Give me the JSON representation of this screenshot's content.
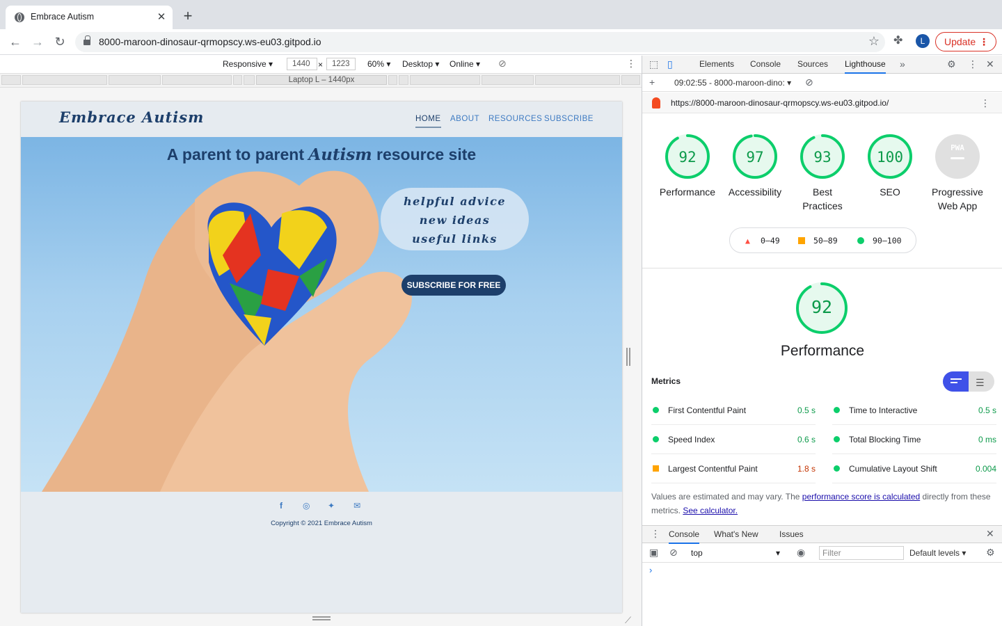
{
  "browser": {
    "tab_title": "Embrace Autism",
    "url": "8000-maroon-dinosaur-qrmopscy.ws-eu03.gitpod.io",
    "avatar_letter": "L",
    "update_label": "Update"
  },
  "device_toolbar": {
    "mode": "Responsive",
    "width": "1440",
    "height": "1223",
    "zoom": "60%",
    "device_type": "Desktop",
    "throttle": "Online",
    "media_query_label": "Laptop L – 1440px"
  },
  "site": {
    "logo": "Embrace Autism",
    "nav": [
      "HOME",
      "ABOUT",
      "RESOURCES",
      "SUBSCRIBE"
    ],
    "hero_title_before": "A parent to parent ",
    "hero_title_em": "Autism",
    "hero_title_after": " resource site",
    "cloud_lines": [
      "helpful advice",
      "new ideas",
      "useful links"
    ],
    "subscribe_button": "SUBSCRIBE FOR FREE",
    "copyright": "Copyright © 2021 Embrace Autism",
    "social_icons": [
      "facebook-icon",
      "instagram-icon",
      "twitter-icon",
      "email-icon"
    ]
  },
  "devtools": {
    "tabs": [
      "Elements",
      "Console",
      "Sources",
      "Lighthouse"
    ],
    "report_time": "09:02:55 - 8000-maroon-dino:",
    "report_url": "https://8000-maroon-dinosaur-qrmopscy.ws-eu03.gitpod.io/",
    "gauges": [
      {
        "score": "92",
        "label": "Performance",
        "value": 92
      },
      {
        "score": "97",
        "label": "Accessibility",
        "value": 97
      },
      {
        "score": "93",
        "label": "Best Practices",
        "value": 93
      },
      {
        "score": "100",
        "label": "SEO",
        "value": 100
      },
      {
        "score": "PWA",
        "label": "Progressive Web App",
        "value": 0
      }
    ],
    "legend": [
      "0–49",
      "50–89",
      "90–100"
    ],
    "perf_score": "92",
    "perf_title": "Performance",
    "metrics_header": "Metrics",
    "metrics": [
      {
        "name": "First Contentful Paint",
        "value": "0.5 s",
        "status": "good"
      },
      {
        "name": "Time to Interactive",
        "value": "0.5 s",
        "status": "good"
      },
      {
        "name": "Speed Index",
        "value": "0.6 s",
        "status": "good"
      },
      {
        "name": "Total Blocking Time",
        "value": "0 ms",
        "status": "good"
      },
      {
        "name": "Largest Contentful Paint",
        "value": "1.8 s",
        "status": "average"
      },
      {
        "name": "Cumulative Layout Shift",
        "value": "0.004",
        "status": "good"
      }
    ],
    "note_before": "Values are estimated and may vary. The ",
    "note_link1": "performance score is calculated",
    "note_middle": " directly from these metrics. ",
    "note_link2": "See calculator.",
    "drawer_tabs": [
      "Console",
      "What's New",
      "Issues"
    ],
    "context": "top",
    "filter_placeholder": "Filter",
    "levels": "Default levels",
    "colors": {
      "good": "#0cce6b",
      "average": "#ffa400",
      "fail": "#ff4e42",
      "accent": "#1a73e8"
    }
  }
}
